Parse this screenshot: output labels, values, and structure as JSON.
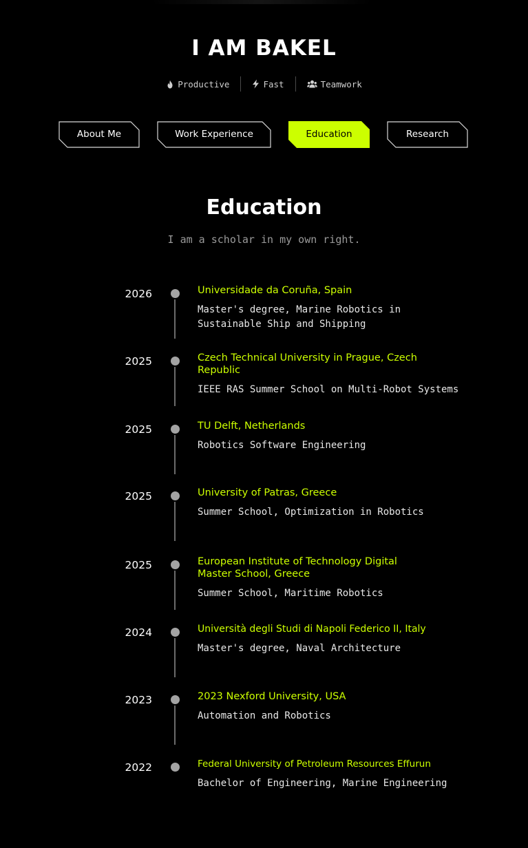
{
  "hero": {
    "title": "I AM BAKEL"
  },
  "traits": [
    {
      "icon": "flame-icon",
      "label": "Productive"
    },
    {
      "icon": "bolt-icon",
      "label": "Fast"
    },
    {
      "icon": "users-icon",
      "label": "Teamwork"
    }
  ],
  "tabs": [
    {
      "label": "About Me",
      "active": false
    },
    {
      "label": "Work Experience",
      "active": false
    },
    {
      "label": "Education",
      "active": true
    },
    {
      "label": "Research",
      "active": false
    }
  ],
  "section": {
    "title": "Education",
    "subtitle": "I am a scholar in my own right."
  },
  "education": [
    {
      "year": "2026",
      "institution": "Universidade da Coruña, Spain",
      "description": "Master's degree, Marine Robotics in Sustainable Ship and Shipping"
    },
    {
      "year": "2025",
      "institution": "Czech Technical University in Prague, Czech Republic",
      "description": "IEEE RAS Summer School on Multi-Robot Systems"
    },
    {
      "year": "2025",
      "institution": "TU Delft, Netherlands",
      "description": "Robotics Software Engineering"
    },
    {
      "year": "2025",
      "institution": "University of Patras, Greece",
      "description": "Summer School, Optimization in Robotics"
    },
    {
      "year": "2025",
      "institution": "European Institute of Technology Digital Master School, Greece",
      "description": "Summer School, Maritime Robotics"
    },
    {
      "year": "2024",
      "institution": "Università degli Studi di Napoli Federico II, Italy",
      "description": "Master's degree, Naval Architecture"
    },
    {
      "year": "2023",
      "institution": "2023 Nexford University, USA",
      "description": "Automation and Robotics"
    },
    {
      "year": "2022",
      "institution": "Federal University of Petroleum Resources Effurun",
      "description": "Bachelor of Engineering, Marine Engineering"
    }
  ],
  "colors": {
    "accent": "#ccff00",
    "background": "#000000",
    "text": "#ffffff",
    "muted": "#9a9a9a"
  }
}
